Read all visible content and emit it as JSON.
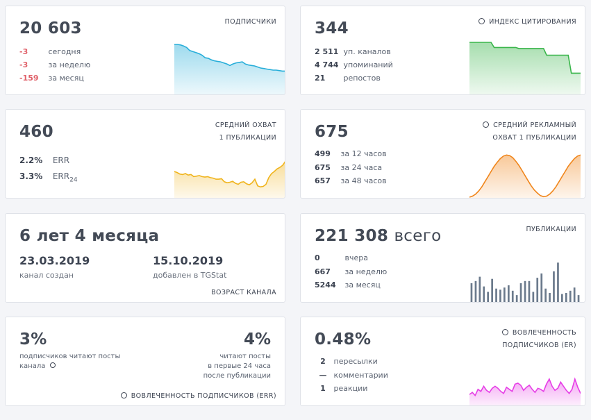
{
  "subscribers": {
    "value": "20 603",
    "label": "ПОДПИСЧИКИ",
    "rows": [
      {
        "value": "-3",
        "text": "сегодня"
      },
      {
        "value": "-3",
        "text": "за неделю"
      },
      {
        "value": "-159",
        "text": "за месяц"
      }
    ],
    "color": "#27aed9"
  },
  "citation": {
    "value": "344",
    "label": "ИНДЕКС ЦИТИРОВАНИЯ",
    "rows": [
      {
        "value": "2 511",
        "text": "уп. каналов"
      },
      {
        "value": "4 744",
        "text": "упоминаний"
      },
      {
        "value": "21",
        "text": "репостов"
      }
    ],
    "color": "#39b54a"
  },
  "reach": {
    "value": "460",
    "label_line1": "СРЕДНИЙ ОХВАТ",
    "label_line2": "1 ПУБЛИКАЦИИ",
    "rows": [
      {
        "value": "2.2%",
        "text": "ERR"
      },
      {
        "value": "3.3%",
        "text": "ERR",
        "sub": "24"
      }
    ],
    "color": "#f0b41c"
  },
  "ad_reach": {
    "value": "675",
    "label_line1": "СРЕДНИЙ РЕКЛАМНЫЙ",
    "label_line2": "ОХВАТ 1 ПУБЛИКАЦИИ",
    "rows": [
      {
        "value": "499",
        "text": "за 12 часов"
      },
      {
        "value": "675",
        "text": "за 24 часа"
      },
      {
        "value": "657",
        "text": "за 48 часов"
      }
    ],
    "color": "#f0861c"
  },
  "age": {
    "value": "6 лет 4 месяца",
    "created_date": "23.03.2019",
    "created_label": "канал создан",
    "added_date": "15.10.2019",
    "added_label": "добавлен в TGStat",
    "label": "ВОЗРАСТ КАНАЛА"
  },
  "posts": {
    "value": "221 308",
    "suffix": "всего",
    "label": "ПУБЛИКАЦИИ",
    "rows": [
      {
        "value": "0",
        "text": "вчера"
      },
      {
        "value": "667",
        "text": "за неделю"
      },
      {
        "value": "5244",
        "text": "за месяц"
      }
    ],
    "color": "#6b7a8c"
  },
  "engagement": {
    "left_value": "3%",
    "left_text_line1": "подписчиков читают посты",
    "left_text_line2": "канала",
    "right_value": "4%",
    "right_text_line1": "читают посты",
    "right_text_line2": "в первые 24 часа",
    "right_text_line3": "после публикации",
    "label": "ВОВЛЕЧЕННОСТЬ ПОДПИСЧИКОВ (ERR)"
  },
  "er": {
    "value": "0.48%",
    "label_line1": "ВОВЛЕЧЕННОСТЬ",
    "label_line2": "ПОДПИСЧИКОВ (ER)",
    "rows": [
      {
        "value": "2",
        "text": "пересылки"
      },
      {
        "value": "—",
        "text": "комментарии"
      },
      {
        "value": "1",
        "text": "реакции"
      }
    ],
    "color": "#e63ee6"
  },
  "chart_data": [
    {
      "type": "area",
      "name_ref": "subscribers",
      "values": [
        96,
        96,
        95,
        93,
        90,
        84,
        82,
        80,
        78,
        75,
        70,
        69,
        66,
        64,
        63,
        62,
        60,
        58,
        55,
        58,
        60,
        61,
        62,
        58,
        56,
        55,
        54,
        52,
        50,
        49,
        48,
        47,
        46,
        46,
        45,
        44,
        44
      ]
    },
    {
      "type": "area",
      "name_ref": "citation",
      "values": [
        100,
        100,
        100,
        100,
        100,
        100,
        100,
        100,
        90,
        90,
        90,
        90,
        90,
        90,
        90,
        90,
        88,
        88,
        88,
        88,
        88,
        88,
        88,
        88,
        88,
        75,
        75,
        75,
        75,
        75,
        75,
        75,
        75,
        40,
        40,
        40,
        40
      ]
    },
    {
      "type": "area",
      "name_ref": "reach",
      "values": [
        50,
        48,
        45,
        44,
        46,
        43,
        44,
        40,
        41,
        42,
        40,
        39,
        40,
        38,
        37,
        35,
        35,
        36,
        30,
        28,
        29,
        31,
        27,
        25,
        29,
        30,
        26,
        24,
        28,
        35,
        22,
        20,
        21,
        25,
        38,
        46,
        50,
        55,
        58,
        62,
        70
      ]
    },
    {
      "type": "area",
      "name_ref": "ad_reach",
      "values": [
        0,
        2,
        6,
        12,
        20,
        30,
        40,
        50,
        60,
        68,
        75,
        80,
        82,
        81,
        77,
        70,
        62,
        52,
        42,
        32,
        22,
        14,
        8,
        3,
        1,
        2,
        6,
        12,
        20,
        30,
        40,
        50,
        60,
        68,
        75,
        80,
        82
      ]
    },
    {
      "type": "bar",
      "name_ref": "posts",
      "values": [
        36,
        40,
        48,
        30,
        20,
        44,
        26,
        24,
        28,
        32,
        22,
        14,
        36,
        40,
        40,
        20,
        46,
        54,
        26,
        18,
        58,
        74,
        16,
        18,
        22,
        28,
        14
      ]
    },
    {
      "type": "area",
      "name_ref": "er",
      "values": [
        20,
        24,
        18,
        30,
        26,
        36,
        28,
        24,
        32,
        36,
        32,
        26,
        22,
        34,
        30,
        26,
        40,
        42,
        38,
        28,
        34,
        38,
        30,
        24,
        32,
        30,
        26,
        40,
        50,
        36,
        28,
        32,
        44,
        36,
        28,
        22,
        30,
        50,
        34,
        22
      ]
    }
  ]
}
